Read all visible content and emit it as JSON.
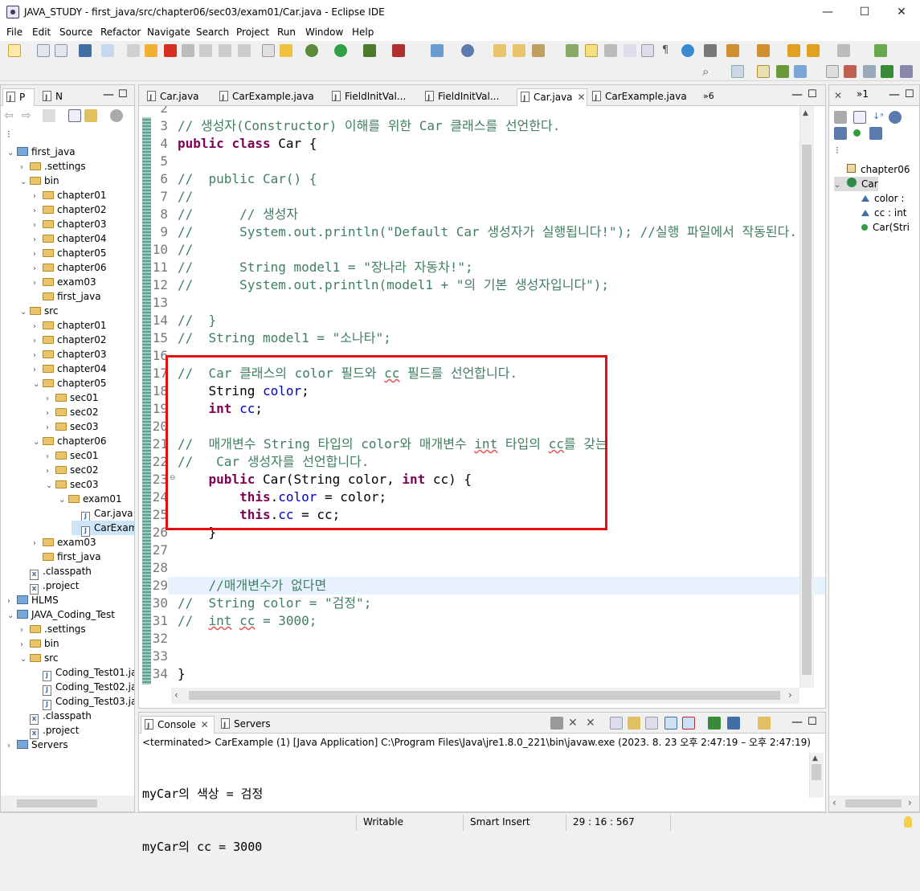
{
  "window": {
    "title": "JAVA_STUDY - first_java/src/chapter06/sec03/exam01/Car.java - Eclipse IDE",
    "minimize": "—",
    "maximize": "☐",
    "close": "✕"
  },
  "menu": [
    "File",
    "Edit",
    "Source",
    "Refactor",
    "Navigate",
    "Search",
    "Project",
    "Run",
    "Window",
    "Help"
  ],
  "explorer": {
    "tabs": [
      "P",
      "N"
    ],
    "items": [
      {
        "label": "first_java",
        "arrow": "⌄",
        "kind": "project",
        "level": 0
      },
      {
        "label": ".settings",
        "arrow": "›",
        "kind": "folder",
        "level": 1
      },
      {
        "label": "bin",
        "arrow": "⌄",
        "kind": "folder",
        "level": 1
      },
      {
        "label": "chapter01",
        "arrow": "›",
        "kind": "folder",
        "level": 2
      },
      {
        "label": "chapter02",
        "arrow": "›",
        "kind": "folder",
        "level": 2
      },
      {
        "label": "chapter03",
        "arrow": "›",
        "kind": "folder",
        "level": 2
      },
      {
        "label": "chapter04",
        "arrow": "›",
        "kind": "folder",
        "level": 2
      },
      {
        "label": "chapter05",
        "arrow": "›",
        "kind": "folder",
        "level": 2
      },
      {
        "label": "chapter06",
        "arrow": "›",
        "kind": "folder",
        "level": 2
      },
      {
        "label": "exam03",
        "arrow": "›",
        "kind": "folder",
        "level": 2
      },
      {
        "label": "first_java",
        "arrow": "",
        "kind": "folder",
        "level": 2
      },
      {
        "label": "src",
        "arrow": "⌄",
        "kind": "folder",
        "level": 1
      },
      {
        "label": "chapter01",
        "arrow": "›",
        "kind": "folder",
        "level": 2
      },
      {
        "label": "chapter02",
        "arrow": "›",
        "kind": "folder",
        "level": 2
      },
      {
        "label": "chapter03",
        "arrow": "›",
        "kind": "folder",
        "level": 2
      },
      {
        "label": "chapter04",
        "arrow": "›",
        "kind": "folder",
        "level": 2
      },
      {
        "label": "chapter05",
        "arrow": "⌄",
        "kind": "folder",
        "level": 2
      },
      {
        "label": "sec01",
        "arrow": "›",
        "kind": "folder",
        "level": 3
      },
      {
        "label": "sec02",
        "arrow": "›",
        "kind": "folder",
        "level": 3
      },
      {
        "label": "sec03",
        "arrow": "›",
        "kind": "folder",
        "level": 3
      },
      {
        "label": "chapter06",
        "arrow": "⌄",
        "kind": "folder",
        "level": 2
      },
      {
        "label": "sec01",
        "arrow": "›",
        "kind": "folder",
        "level": 3
      },
      {
        "label": "sec02",
        "arrow": "›",
        "kind": "folder",
        "level": 3
      },
      {
        "label": "sec03",
        "arrow": "⌄",
        "kind": "folder",
        "level": 3
      },
      {
        "label": "exam01",
        "arrow": "⌄",
        "kind": "folder",
        "level": 4
      },
      {
        "label": "Car.java",
        "arrow": "",
        "kind": "file",
        "level": 5
      },
      {
        "label": "CarExam",
        "arrow": "",
        "kind": "file",
        "level": 5,
        "selected": true
      },
      {
        "label": "exam03",
        "arrow": "›",
        "kind": "folder",
        "level": 2
      },
      {
        "label": "first_java",
        "arrow": "",
        "kind": "folder",
        "level": 2
      },
      {
        "label": ".classpath",
        "arrow": "",
        "kind": "xml",
        "level": 1
      },
      {
        "label": ".project",
        "arrow": "",
        "kind": "xml",
        "level": 1
      },
      {
        "label": "HLMS",
        "arrow": "›",
        "kind": "project",
        "level": 0
      },
      {
        "label": "JAVA_Coding_Test",
        "arrow": "⌄",
        "kind": "project",
        "level": 0
      },
      {
        "label": ".settings",
        "arrow": "›",
        "kind": "folder",
        "level": 1
      },
      {
        "label": "bin",
        "arrow": "›",
        "kind": "folder",
        "level": 1
      },
      {
        "label": "src",
        "arrow": "⌄",
        "kind": "folder",
        "level": 1
      },
      {
        "label": "Coding_Test01.ja",
        "arrow": "",
        "kind": "file",
        "level": 2
      },
      {
        "label": "Coding_Test02.ja",
        "arrow": "",
        "kind": "file",
        "level": 2
      },
      {
        "label": "Coding_Test03.ja",
        "arrow": "",
        "kind": "file",
        "level": 2
      },
      {
        "label": ".classpath",
        "arrow": "",
        "kind": "xml",
        "level": 1
      },
      {
        "label": ".project",
        "arrow": "",
        "kind": "xml",
        "level": 1
      },
      {
        "label": "Servers",
        "arrow": "›",
        "kind": "project",
        "level": 0
      }
    ]
  },
  "editor_tabs": [
    {
      "label": "Car.java",
      "active": false
    },
    {
      "label": "CarExample.java",
      "active": false
    },
    {
      "label": "FieldInitVal...",
      "active": false
    },
    {
      "label": "FieldInitVal...",
      "active": false
    },
    {
      "label": "Car.java",
      "active": true
    },
    {
      "label": "CarExample.java",
      "active": false
    }
  ],
  "editor_overflow": "»6",
  "code": [
    {
      "n": "2",
      "tokens": []
    },
    {
      "n": "3",
      "tokens": [
        [
          "cm",
          "// 생성자(Constructor) 이해를 위한 Car 클래스를 선언한다."
        ]
      ]
    },
    {
      "n": "4",
      "tokens": [
        [
          "kw",
          "public"
        ],
        [
          "",
          " "
        ],
        [
          "kw",
          "class"
        ],
        [
          "",
          " Car {"
        ]
      ]
    },
    {
      "n": "5",
      "tokens": []
    },
    {
      "n": "6",
      "tokens": [
        [
          "cm",
          "//  public Car() {"
        ]
      ]
    },
    {
      "n": "7",
      "tokens": [
        [
          "cm",
          "//"
        ]
      ]
    },
    {
      "n": "8",
      "tokens": [
        [
          "cm",
          "//      // 생성자"
        ]
      ]
    },
    {
      "n": "9",
      "tokens": [
        [
          "cm",
          "//      System.out.println(\"Default Car 생성자가 실행됩니다!\"); //실행 파일에서 작동된다."
        ]
      ]
    },
    {
      "n": "10",
      "tokens": [
        [
          "cm",
          "//"
        ]
      ]
    },
    {
      "n": "11",
      "tokens": [
        [
          "cm",
          "//      String model1 = \"장나라 자동차!\";"
        ]
      ]
    },
    {
      "n": "12",
      "tokens": [
        [
          "cm",
          "//      System.out.println(model1 + \"의 기본 생성자입니다\");"
        ]
      ]
    },
    {
      "n": "13",
      "tokens": []
    },
    {
      "n": "14",
      "tokens": [
        [
          "cm",
          "//  }"
        ]
      ]
    },
    {
      "n": "15",
      "tokens": [
        [
          "cm",
          "//  String model1 = \"소나타\";"
        ]
      ]
    },
    {
      "n": "16",
      "tokens": []
    },
    {
      "n": "17",
      "tokens": [
        [
          "cm",
          "//  Car 클래스의 color 필드와 "
        ],
        [
          "cm sq",
          "cc"
        ],
        [
          "cm",
          " 필드를 선언합니다."
        ]
      ]
    },
    {
      "n": "18",
      "tokens": [
        [
          "",
          "    String "
        ],
        [
          "fld",
          "color"
        ],
        [
          "",
          ";"
        ]
      ]
    },
    {
      "n": "19",
      "tokens": [
        [
          "",
          "    "
        ],
        [
          "kw",
          "int"
        ],
        [
          "",
          " "
        ],
        [
          "fld",
          "cc"
        ],
        [
          "",
          ";"
        ]
      ]
    },
    {
      "n": "20",
      "tokens": []
    },
    {
      "n": "21",
      "tokens": [
        [
          "cm",
          "//  매개변수 String 타입의 color와 매개변수 "
        ],
        [
          "cm sq",
          "int"
        ],
        [
          "cm",
          " 타입의 "
        ],
        [
          "cm sq",
          "cc"
        ],
        [
          "cm",
          "를 갖는"
        ]
      ]
    },
    {
      "n": "22",
      "tokens": [
        [
          "cm",
          "//   Car 생성자를 선언합니다."
        ]
      ]
    },
    {
      "n": "23",
      "tokens": [
        [
          "",
          "    "
        ],
        [
          "kw",
          "public"
        ],
        [
          "",
          " Car(String color, "
        ],
        [
          "kw",
          "int"
        ],
        [
          "",
          " cc) {"
        ]
      ]
    },
    {
      "n": "24",
      "tokens": [
        [
          "",
          "        "
        ],
        [
          "kw",
          "this"
        ],
        [
          "",
          "."
        ],
        [
          "fld",
          "color"
        ],
        [
          "",
          " = color;"
        ]
      ]
    },
    {
      "n": "25",
      "tokens": [
        [
          "",
          "        "
        ],
        [
          "kw",
          "this"
        ],
        [
          "",
          "."
        ],
        [
          "fld",
          "cc"
        ],
        [
          "",
          " = cc;"
        ]
      ]
    },
    {
      "n": "26",
      "tokens": [
        [
          "",
          "    }"
        ]
      ]
    },
    {
      "n": "27",
      "tokens": []
    },
    {
      "n": "28",
      "tokens": []
    },
    {
      "n": "29",
      "tokens": [
        [
          "cm",
          "    //매개변수가 없다면"
        ]
      ]
    },
    {
      "n": "30",
      "tokens": [
        [
          "cm",
          "//  String color = \"검정\";"
        ]
      ]
    },
    {
      "n": "31",
      "tokens": [
        [
          "cm",
          "//  "
        ],
        [
          "cm sq",
          "int"
        ],
        [
          "cm",
          " "
        ],
        [
          "cm sq",
          "cc"
        ],
        [
          "cm",
          " = 3000;"
        ]
      ]
    },
    {
      "n": "32",
      "tokens": []
    },
    {
      "n": "33",
      "tokens": []
    },
    {
      "n": "34",
      "tokens": [
        [
          "",
          "}"
        ]
      ]
    },
    {
      "n": "35",
      "tokens": []
    }
  ],
  "outline": {
    "items": [
      {
        "label": "chapter06",
        "level": 0,
        "arrow": ""
      },
      {
        "label": "Car",
        "level": 0,
        "arrow": "⌄",
        "selected": true
      },
      {
        "label": "color :",
        "level": 1,
        "arrow": ""
      },
      {
        "label": "cc : int",
        "level": 1,
        "arrow": ""
      },
      {
        "label": "Car(Stri",
        "level": 1,
        "arrow": ""
      }
    ]
  },
  "console": {
    "tabs": [
      "Console",
      "Servers"
    ],
    "header": "<terminated> CarExample (1) [Java Application] C:\\Program Files\\Java\\jre1.8.0_221\\bin\\javaw.exe  (2023. 8. 23 오후 2:47:19 – 오후 2:47:19)",
    "lines": [
      "myCar의 색상 = 검정",
      "myCar의 cc = 3000"
    ]
  },
  "status": {
    "writable": "Writable",
    "insert_mode": "Smart Insert",
    "position": "29 : 16 : 567"
  },
  "colors": {
    "keyword": "#7f0055",
    "comment": "#3f7f5f",
    "field": "#0000c0",
    "highlight_box": "#e01010"
  }
}
